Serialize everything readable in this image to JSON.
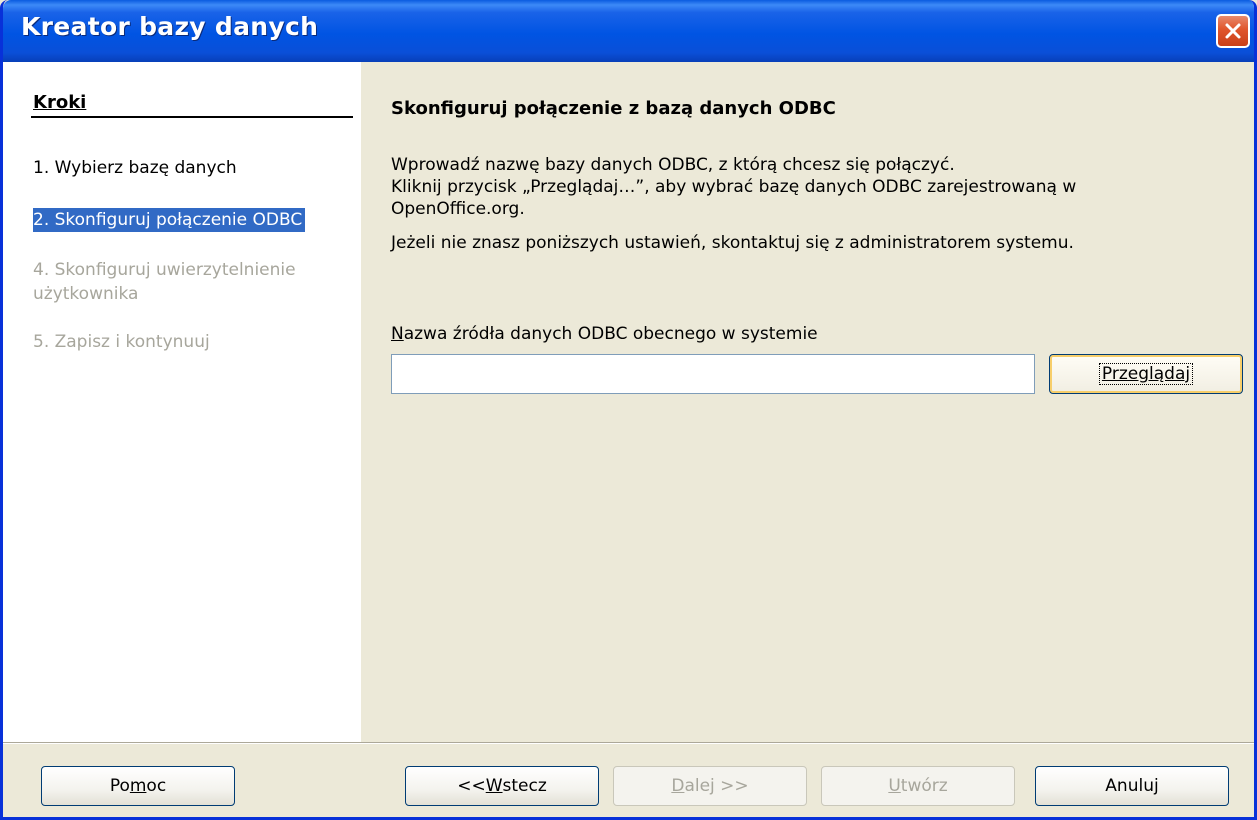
{
  "window": {
    "title": "Kreator bazy danych"
  },
  "sidebar": {
    "heading": "Kroki",
    "steps": [
      {
        "label": "1. Wybierz bazę danych",
        "state": "normal"
      },
      {
        "label": "2. Skonfiguruj połączenie ODBC",
        "state": "active"
      },
      {
        "label": "4. Skonfiguruj uwierzytelnienie",
        "label_line2": "użytkownika",
        "state": "disabled"
      },
      {
        "label": "5. Zapisz i kontynuuj",
        "state": "disabled"
      }
    ]
  },
  "main": {
    "heading": "Skonfiguruj połączenie z bazą danych ODBC",
    "description_lines": [
      "Wprowadź nazwę bazy danych ODBC, z którą chcesz się połączyć.",
      "Kliknij przycisk „Przeglądaj…”, aby wybrać bazę danych ODBC zarejestrowaną w",
      "OpenOffice.org.",
      "Jeżeli nie znasz poniższych ustawień, skontaktuj się z administratorem systemu."
    ],
    "field_label_mnemonic": "N",
    "field_label_rest": "azwa źródła danych ODBC obecnego w systemie",
    "field_value": "",
    "browse_label": "Przeglądaj"
  },
  "footer": {
    "help": {
      "pre": "Po",
      "mn": "m",
      "post": "oc"
    },
    "back": {
      "pre": "<< ",
      "mn": "W",
      "post": "stecz"
    },
    "next": {
      "pre": "",
      "mn": "D",
      "post": "alej >>"
    },
    "create": {
      "pre": "",
      "mn": "U",
      "post": "twórz"
    },
    "cancel": {
      "pre": "",
      "mn": "",
      "post": "Anuluj"
    }
  }
}
